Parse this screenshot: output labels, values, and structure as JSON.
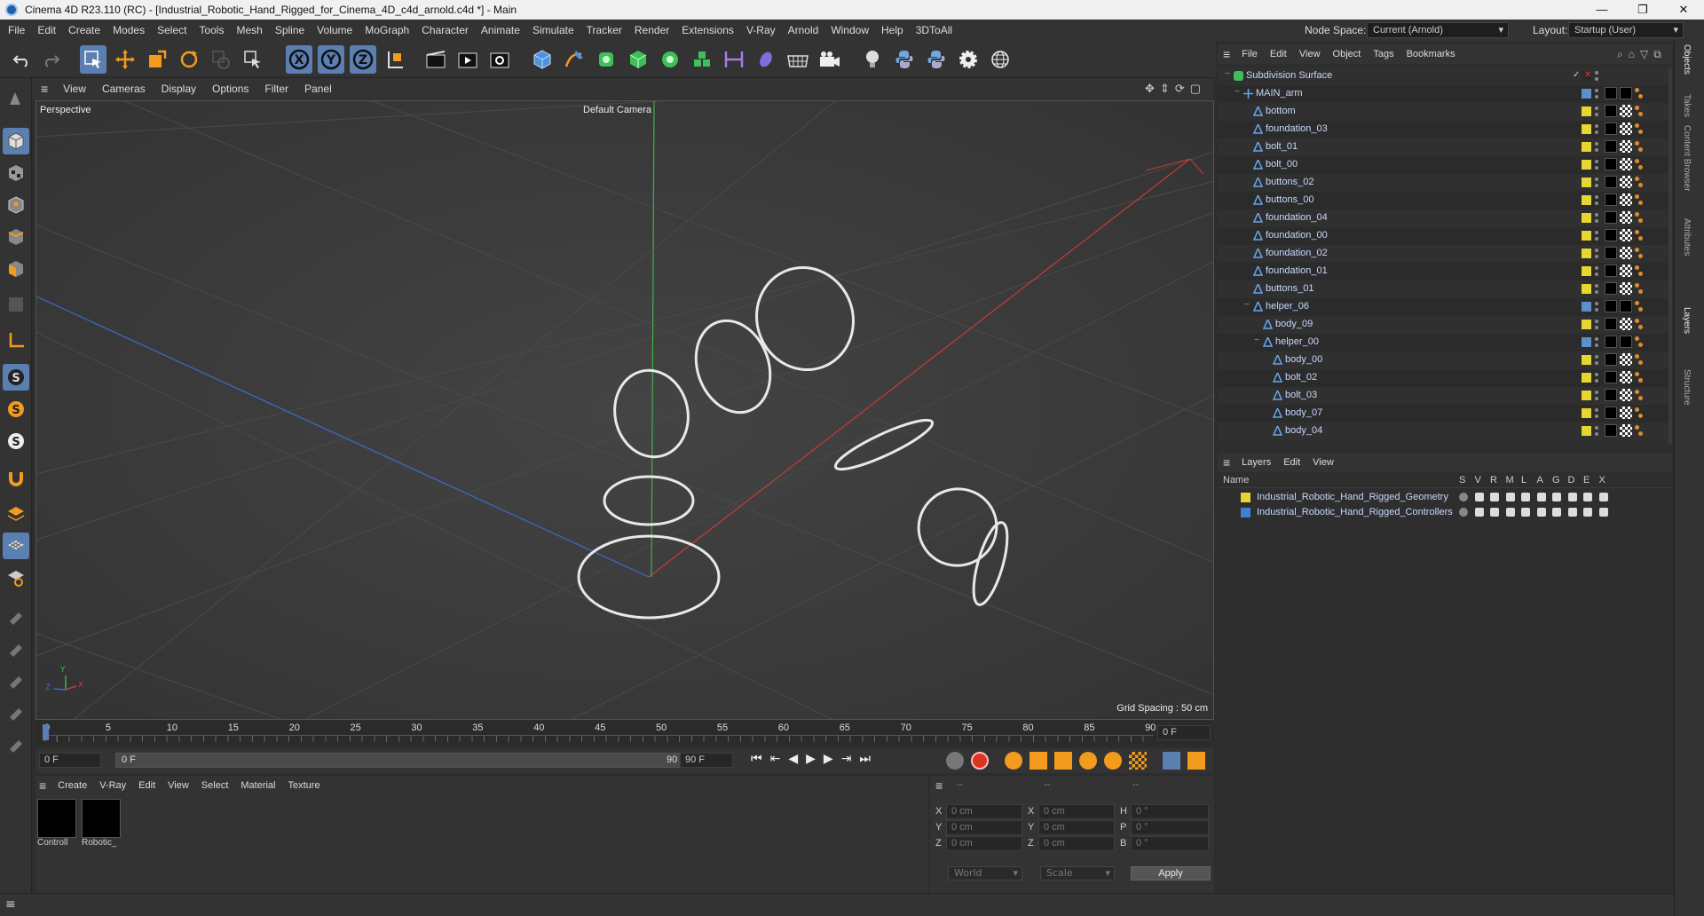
{
  "title": {
    "text": "Cinema 4D R23.110 (RC) - [Industrial_Robotic_Hand_Rigged_for_Cinema_4D_c4d_arnold.c4d *] - Main",
    "minimize": "—",
    "maximize": "❐",
    "close": "✕"
  },
  "menu": [
    "File",
    "Edit",
    "Create",
    "Modes",
    "Select",
    "Tools",
    "Mesh",
    "Spline",
    "Volume",
    "MoGraph",
    "Character",
    "Animate",
    "Simulate",
    "Tracker",
    "Render",
    "Extensions",
    "V-Ray",
    "Arnold",
    "Window",
    "Help",
    "3DToAll"
  ],
  "node_space": {
    "label": "Node Space:",
    "value": "Current (Arnold)"
  },
  "layout": {
    "label": "Layout:",
    "value": "Startup (User)"
  },
  "viewport": {
    "menu": [
      "View",
      "Cameras",
      "Display",
      "Options",
      "Filter",
      "Panel"
    ],
    "name": "Perspective",
    "camera": "Default Camera",
    "grid_spacing": "Grid Spacing : 50 cm",
    "axis": {
      "x": "X",
      "y": "Y",
      "z": "Z"
    }
  },
  "timeline": {
    "ticks": [
      "0",
      "5",
      "10",
      "15",
      "20",
      "25",
      "30",
      "35",
      "40",
      "45",
      "50",
      "55",
      "60",
      "65",
      "70",
      "75",
      "80",
      "85",
      "90"
    ],
    "current_frame": "0 F"
  },
  "transport": {
    "start": "0 F",
    "range_start": "0 F",
    "range_end": "90 F",
    "end": "90 F"
  },
  "materials": {
    "menu": [
      "Create",
      "V-Ray",
      "Edit",
      "View",
      "Select",
      "Material",
      "Texture"
    ],
    "items": [
      {
        "name": "Controll"
      },
      {
        "name": "Robotic_"
      }
    ]
  },
  "coords": {
    "headers": [
      "--",
      "--",
      "--"
    ],
    "rows": [
      {
        "a": "X",
        "av": "0 cm",
        "b": "X",
        "bv": "0 cm",
        "c": "H",
        "cv": "0 °"
      },
      {
        "a": "Y",
        "av": "0 cm",
        "b": "Y",
        "bv": "0 cm",
        "c": "P",
        "cv": "0 °"
      },
      {
        "a": "Z",
        "av": "0 cm",
        "b": "Z",
        "bv": "0 cm",
        "c": "B",
        "cv": "0 °"
      }
    ],
    "world": "World",
    "scale": "Scale",
    "apply": "Apply"
  },
  "objects": {
    "menu": [
      "File",
      "Edit",
      "View",
      "Object",
      "Tags",
      "Bookmarks"
    ],
    "items": [
      {
        "name": "Subdivision Surface",
        "depth": 0,
        "color": "#2a2a2a",
        "tag": "none",
        "fold": "−",
        "icon": "subdiv"
      },
      {
        "name": "MAIN_arm",
        "depth": 1,
        "color": "#5b8fcf",
        "tag": "black",
        "fold": "−",
        "icon": "null"
      },
      {
        "name": "bottom",
        "depth": 2,
        "color": "#e6d630",
        "tag": "checker",
        "fold": "",
        "icon": "bone"
      },
      {
        "name": "foundation_03",
        "depth": 2,
        "color": "#e6d630",
        "tag": "checker",
        "fold": "",
        "icon": "bone"
      },
      {
        "name": "bolt_01",
        "depth": 2,
        "color": "#e6d630",
        "tag": "checker",
        "fold": "",
        "icon": "bone"
      },
      {
        "name": "bolt_00",
        "depth": 2,
        "color": "#e6d630",
        "tag": "checker",
        "fold": "",
        "icon": "bone"
      },
      {
        "name": "buttons_02",
        "depth": 2,
        "color": "#e6d630",
        "tag": "checker",
        "fold": "",
        "icon": "bone"
      },
      {
        "name": "buttons_00",
        "depth": 2,
        "color": "#e6d630",
        "tag": "checker",
        "fold": "",
        "icon": "bone"
      },
      {
        "name": "foundation_04",
        "depth": 2,
        "color": "#e6d630",
        "tag": "checker",
        "fold": "",
        "icon": "bone"
      },
      {
        "name": "foundation_00",
        "depth": 2,
        "color": "#e6d630",
        "tag": "checker",
        "fold": "",
        "icon": "bone"
      },
      {
        "name": "foundation_02",
        "depth": 2,
        "color": "#e6d630",
        "tag": "checker",
        "fold": "",
        "icon": "bone"
      },
      {
        "name": "foundation_01",
        "depth": 2,
        "color": "#e6d630",
        "tag": "checker",
        "fold": "",
        "icon": "bone"
      },
      {
        "name": "buttons_01",
        "depth": 2,
        "color": "#e6d630",
        "tag": "checker",
        "fold": "",
        "icon": "bone"
      },
      {
        "name": "helper_06",
        "depth": 2,
        "color": "#5b8fcf",
        "tag": "black",
        "fold": "−",
        "icon": "bone"
      },
      {
        "name": "body_09",
        "depth": 3,
        "color": "#e6d630",
        "tag": "checker",
        "fold": "",
        "icon": "bone"
      },
      {
        "name": "helper_00",
        "depth": 3,
        "color": "#5b8fcf",
        "tag": "black",
        "fold": "−",
        "icon": "bone"
      },
      {
        "name": "body_00",
        "depth": 4,
        "color": "#e6d630",
        "tag": "checker",
        "fold": "",
        "icon": "bone"
      },
      {
        "name": "bolt_02",
        "depth": 4,
        "color": "#e6d630",
        "tag": "checker",
        "fold": "",
        "icon": "bone"
      },
      {
        "name": "bolt_03",
        "depth": 4,
        "color": "#e6d630",
        "tag": "checker",
        "fold": "",
        "icon": "bone"
      },
      {
        "name": "body_07",
        "depth": 4,
        "color": "#e6d630",
        "tag": "checker",
        "fold": "",
        "icon": "bone"
      },
      {
        "name": "body_04",
        "depth": 4,
        "color": "#e6d630",
        "tag": "checker",
        "fold": "",
        "icon": "bone"
      }
    ]
  },
  "layers": {
    "menu": [
      "Layers",
      "Edit",
      "View"
    ],
    "columns": [
      "Name",
      "S",
      "V",
      "R",
      "M",
      "L",
      "A",
      "G",
      "D",
      "E",
      "X"
    ],
    "items": [
      {
        "name": "Industrial_Robotic_Hand_Rigged_Geometry",
        "color": "#e6d630"
      },
      {
        "name": "Industrial_Robotic_Hand_Rigged_Controllers",
        "color": "#3f7fd6"
      }
    ]
  },
  "right_tabs": [
    "Objects",
    "Takes",
    "Content Browser",
    "Attributes",
    "Layers",
    "Structure"
  ],
  "icons": {
    "undo": "undo-icon",
    "redo": "redo-icon",
    "move": "move-icon",
    "rotate": "rotate-icon",
    "scale": "scale-icon",
    "render": "render-icon",
    "cube": "cube-icon",
    "light": "light-icon",
    "python": "python-icon",
    "gear": "gear-icon"
  }
}
